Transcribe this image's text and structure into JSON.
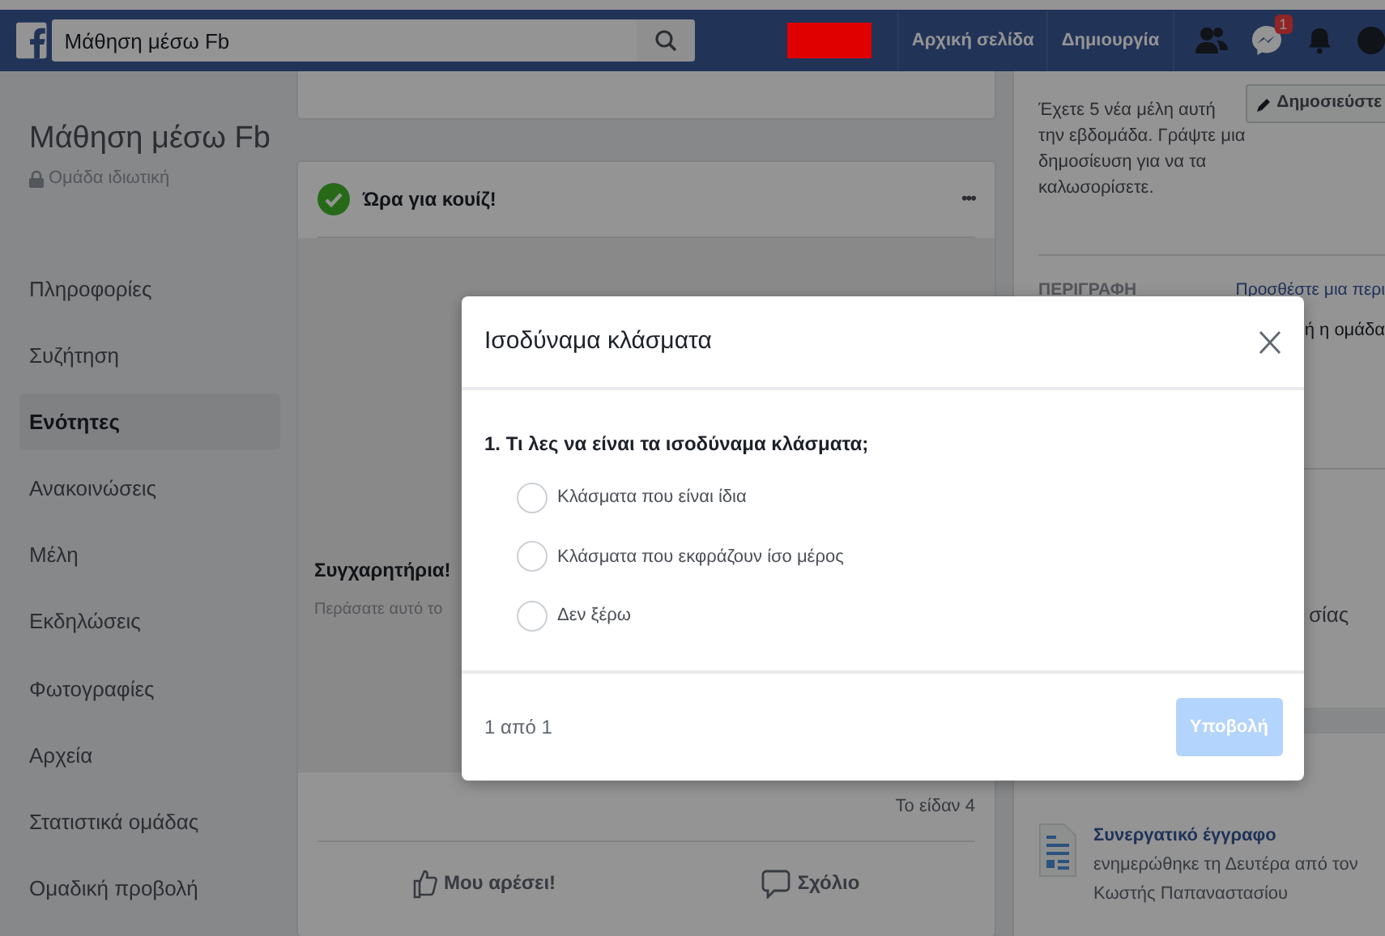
{
  "top_bar": {
    "search": {
      "value": "Μάθηση μέσω Fb"
    },
    "nav_links": [
      "Αρχική σελίδα",
      "Δημιουργία"
    ],
    "messages_badge": "1"
  },
  "sidebar": {
    "group_name": "Μάθηση μέσω Fb",
    "privacy": "Ομάδα ιδιωτική",
    "items": [
      {
        "label": "Πληροφορίες",
        "selected": false
      },
      {
        "label": "Συζήτηση",
        "selected": false
      },
      {
        "label": "Ενότητες",
        "selected": true
      },
      {
        "label": "Ανακοινώσεις",
        "selected": false
      },
      {
        "label": "Μέλη",
        "selected": false
      },
      {
        "label": "Εκδηλώσεις",
        "selected": false
      },
      {
        "label": "Φωτογραφίες",
        "selected": false
      },
      {
        "label": "Αρχεία",
        "selected": false
      },
      {
        "label": "Στατιστικά ομάδας",
        "selected": false
      },
      {
        "label": "Ομαδική προβολή",
        "selected": false
      }
    ]
  },
  "post": {
    "title": "Ώρα για κουίζ!",
    "menu": "•••",
    "heading": "Συγχαρητήρια!",
    "text": "Περάσατε αυτό το",
    "views": "Το είδαν 4",
    "actions": [
      "Μου αρέσει!",
      "Σχόλιο"
    ]
  },
  "right_panel": {
    "new_members": "Έχετε 5 νέα μέλη αυτή την εβδομάδα. Γράψτε μια δημοσίευση για να τα καλωσορίσετε.",
    "post_button": "Δημοσιεύστε",
    "description_label": "ΠΕΡΙΓΡΑΦΗ",
    "description_link": "Προσθέστε μια περι",
    "description_fragment": "ή η ομάδα",
    "fragment_2": "σίας",
    "document": {
      "title": "Συνεργατικό έγγραφο",
      "updated": "ενημερώθηκε τη Δευτέρα από τον",
      "author": "Κωστής Παπαναστασίου"
    }
  },
  "dialog": {
    "title": "Ισοδύναμα κλάσματα",
    "question": "1. Τι λες να είναι τα ισοδύναμα κλάσματα;",
    "options": [
      {
        "label": "Κλάσματα που είναι ίδια",
        "selected": false
      },
      {
        "label": "Κλάσματα που εκφράζουν ίσο μέρος",
        "selected": false
      },
      {
        "label": "Δεν ξέρω",
        "selected": false
      }
    ],
    "progress": "1 από 1",
    "submit": {
      "label": "Υποβολή",
      "disabled": true
    }
  }
}
